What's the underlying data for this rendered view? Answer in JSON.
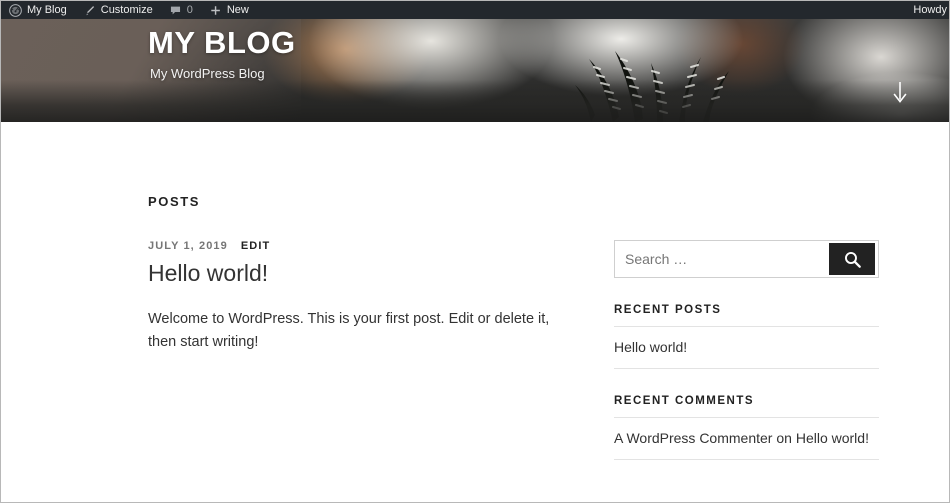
{
  "adminbar": {
    "items": [
      {
        "icon": "wordpress-logo-icon",
        "label": "My Blog"
      },
      {
        "icon": "paintbrush-icon",
        "label": "Customize"
      },
      {
        "icon": "comment-bubble-icon",
        "label": "0"
      },
      {
        "icon": "plus-icon",
        "label": "New"
      }
    ],
    "site_name": "My Blog",
    "customize_label": "Customize",
    "comment_count": "0",
    "new_label": "New",
    "howdy_label": "Howdy",
    "background": "#23282d"
  },
  "header": {
    "site_title": "MY BLOG",
    "tagline": "My WordPress Blog",
    "scroll_icon": "arrow-down-icon"
  },
  "content": {
    "posts_heading": "POSTS",
    "posts": [
      {
        "date": "JULY 1, 2019",
        "edit_label": "EDIT",
        "title": "Hello world!",
        "excerpt": "Welcome to WordPress. This is your first post. Edit or delete it, then start writing!"
      }
    ]
  },
  "sidebar": {
    "search": {
      "placeholder": "Search …",
      "value": "",
      "button_icon": "search-icon"
    },
    "widgets": [
      {
        "title": "RECENT POSTS",
        "items": [
          {
            "text": "Hello world!"
          }
        ]
      },
      {
        "title": "RECENT COMMENTS",
        "items": [
          {
            "author": "A WordPress Commenter",
            "separator": " on ",
            "post": "Hello world!",
            "text": "A WordPress Commenter on Hello world!"
          }
        ]
      }
    ]
  },
  "colors": {
    "adminbar_bg": "#23282d",
    "search_button_bg": "#222222",
    "text": "#333333",
    "muted_text": "#767676",
    "rule": "#e3e3e3"
  }
}
